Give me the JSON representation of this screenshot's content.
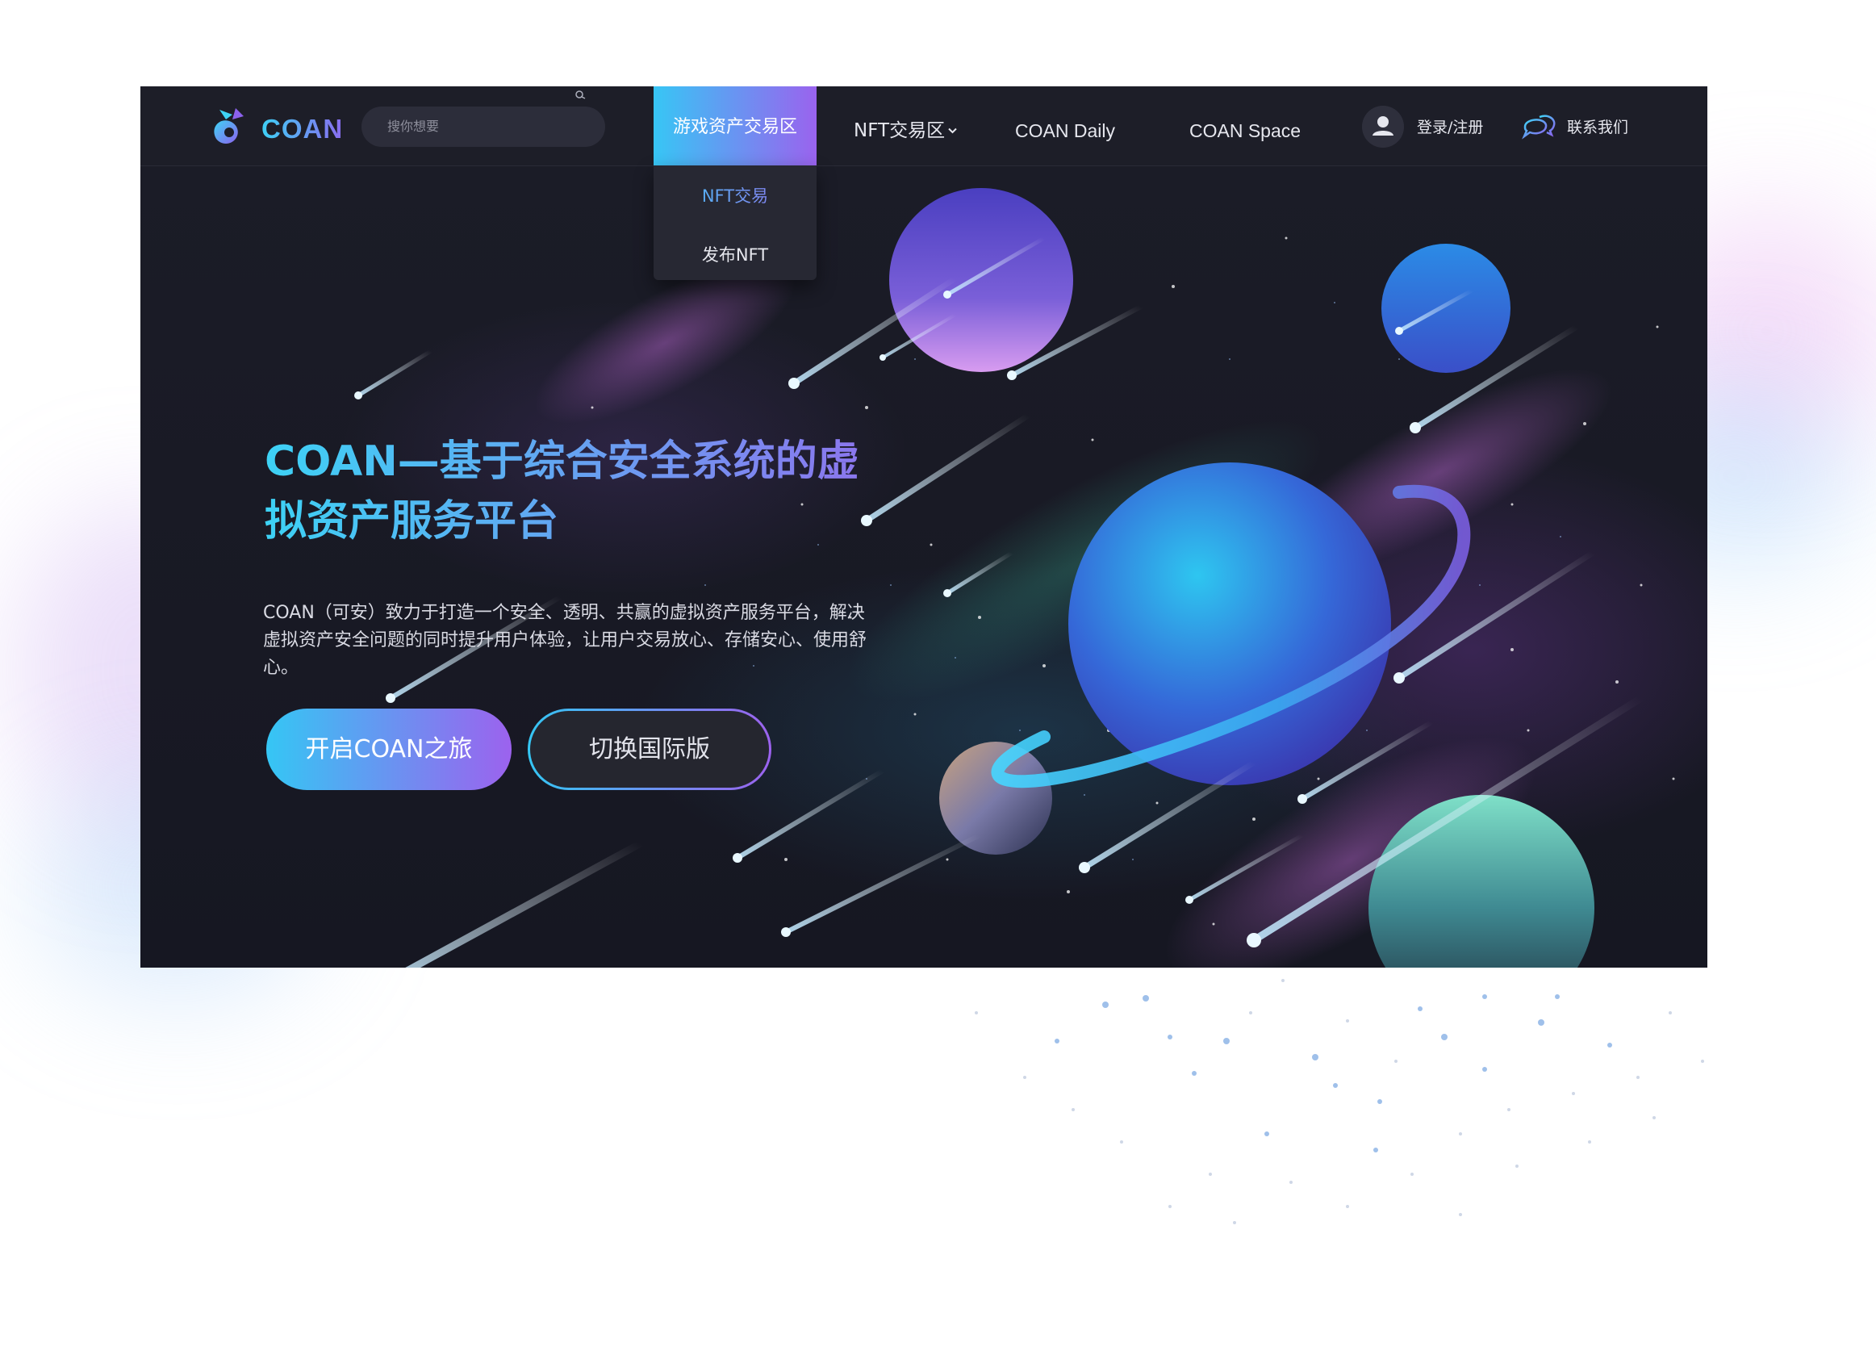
{
  "brand": {
    "name": "COAN"
  },
  "search": {
    "placeholder": "搜你想要"
  },
  "nav": {
    "game_assets": "游戏资产交易区",
    "nft_zone": "NFT交易区",
    "daily": "COAN Daily",
    "space": "COAN Space",
    "login": "登录/注册",
    "contact": "联系我们"
  },
  "dropdown": {
    "items": [
      "NFT交易",
      "发布NFT"
    ]
  },
  "hero": {
    "title_line1": "COAN—基于综合安全系统的虚",
    "title_line2": "拟资产服务平台",
    "description": "COAN（可安）致力于打造一个安全、透明、共赢的虚拟资产服务平台，解决虚拟资产安全问题的同时提升用户体验，让用户交易放心、存储安心、使用舒心。",
    "primary_button": "开启COAN之旅",
    "secondary_button": "切换国际版"
  },
  "colors": {
    "accent_start": "#35c6f4",
    "accent_end": "#9c62ee",
    "window_background": "#171821",
    "navbar_background": "#1d1e28",
    "page_background": "#ffffff"
  },
  "icons": [
    "coan-logo-icon",
    "search-icon",
    "chevron-down-icon",
    "user-avatar-icon",
    "chat-bubbles-icon"
  ]
}
